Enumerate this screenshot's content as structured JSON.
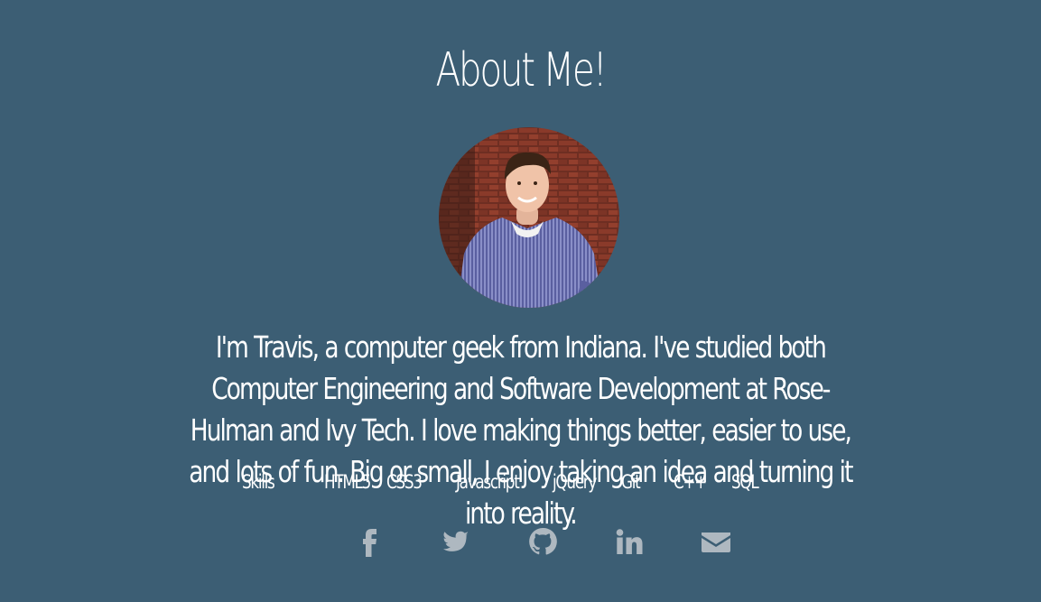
{
  "about": {
    "title": "About Me!",
    "bio": "I'm Travis, a computer geek from Indiana. I've studied both Computer Engineering and Software Development at Rose-Hulman and Ivy Tech. I love making things better, easier to use, and lots of fun. Big or small, I enjoy taking an idea and turning it into reality."
  },
  "skills": {
    "label": "Skills",
    "items": [
      "HTML5",
      "CSS3",
      "Javascript",
      "jQuery",
      "Git",
      "C++",
      "SQL"
    ]
  },
  "social": {
    "icons": [
      "facebook-icon",
      "twitter-icon",
      "github-icon",
      "linkedin-icon",
      "envelope-icon"
    ]
  },
  "colors": {
    "background": "#3c5e74",
    "text": "#ffffff",
    "icon": "#aeb8c0"
  }
}
